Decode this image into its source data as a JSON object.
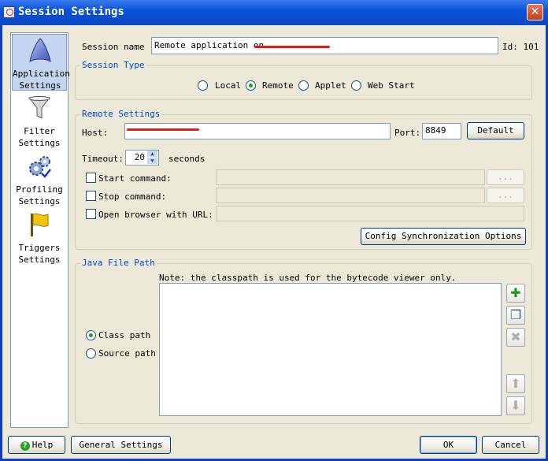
{
  "window": {
    "title": "Session Settings"
  },
  "sidebar": {
    "items": [
      {
        "label": "Application Settings",
        "icon": "application-icon",
        "selected": true
      },
      {
        "label": "Filter Settings",
        "icon": "filter-funnel-icon",
        "selected": false
      },
      {
        "label": "Profiling Settings",
        "icon": "profiling-gears-icon",
        "selected": false
      },
      {
        "label": "Triggers Settings",
        "icon": "triggers-flag-icon",
        "selected": false
      }
    ]
  },
  "session": {
    "name_label": "Session name :",
    "name_value": "Remote application on ",
    "id_label": "Id: 101"
  },
  "session_type": {
    "legend": "Session Type",
    "options": [
      "Local",
      "Remote",
      "Applet",
      "Web Start"
    ],
    "selected": "Remote"
  },
  "remote": {
    "legend": "Remote Settings",
    "host_label": "Host:",
    "port_label": "Port:",
    "port_value": "8849",
    "default_button": "Default",
    "timeout_label": "Timeout:",
    "timeout_value": "20",
    "timeout_unit": "seconds",
    "start_command_label": "Start command:",
    "stop_command_label": "Stop command:",
    "browse_label": "...",
    "open_browser_label": "Open browser with URL:",
    "config_sync_button": "Config Synchronization Options"
  },
  "java_path": {
    "legend": "Java File Path",
    "note": "Note: the classpath is used for the bytecode viewer only.",
    "class_path_label": "Class path",
    "source_path_label": "Source path",
    "selected": "Class path"
  },
  "footer": {
    "help_button": "Help",
    "general_button": "General Settings",
    "ok_button": "OK",
    "cancel_button": "Cancel"
  },
  "colors": {
    "title_bar": "#0a52d8",
    "legend_text": "#0046d5",
    "redaction": "#e41b1b",
    "dialog_bg": "#ece9d8"
  }
}
